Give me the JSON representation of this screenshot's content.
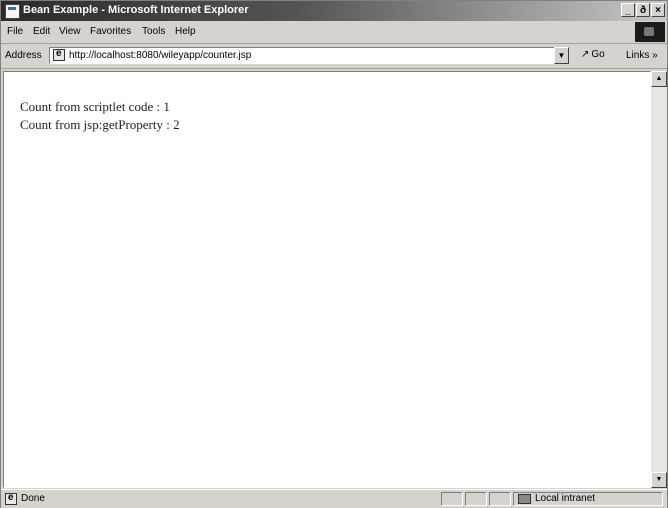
{
  "window": {
    "title": "Bean Example - Microsoft Internet Explorer",
    "controls": {
      "minimize": "_",
      "maximize": "ð",
      "close": "×"
    }
  },
  "menu": {
    "items": [
      "File",
      "Edit",
      "View",
      "Favorites",
      "Tools",
      "Help"
    ]
  },
  "address_bar": {
    "label": "Address",
    "url": "http://localhost:8080/wileyapp/counter.jsp",
    "go_label": "Go",
    "links_label": "Links »"
  },
  "content": {
    "lines": [
      "Count from scriptlet code : 1",
      "Count from jsp:getProperty : 2"
    ]
  },
  "status_bar": {
    "status_text": "Done",
    "zone_label": "Local intranet"
  },
  "icons": {
    "page": "ie-page-icon",
    "go": "go-arrow-icon",
    "zone": "local-intranet-icon"
  }
}
